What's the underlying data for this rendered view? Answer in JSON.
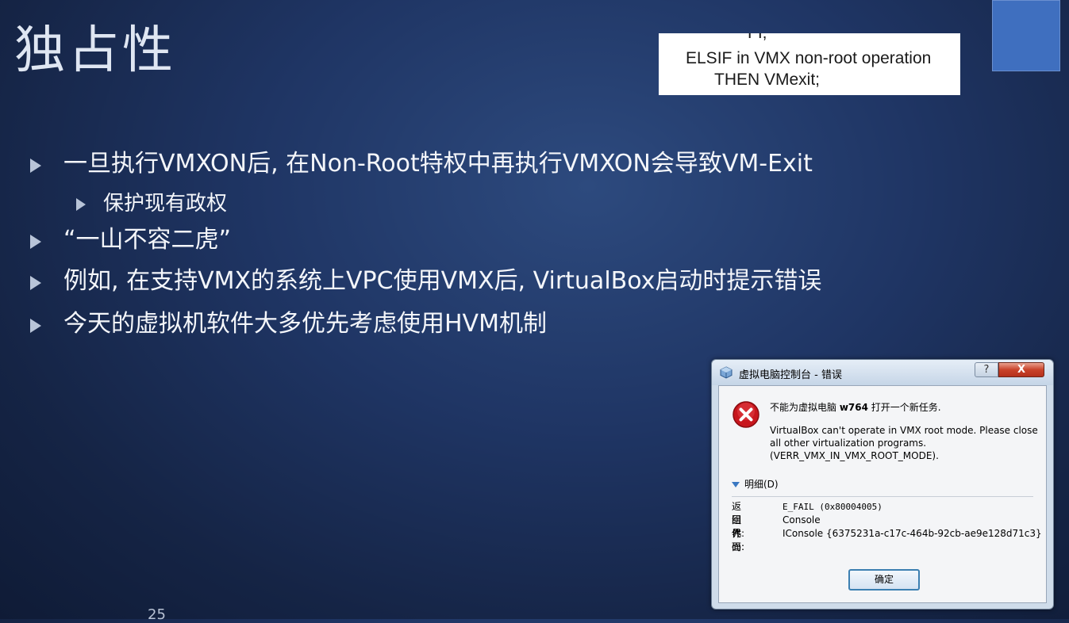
{
  "slide": {
    "title": "独占性",
    "page_number": "25",
    "code_snippet": {
      "line0": "FI;",
      "line1": "ELSIF in VMX non-root operation",
      "line2": "THEN VMexit;"
    },
    "bullets": [
      {
        "text": "一旦执行VMXON后, 在Non-Root特权中再执行VMXON会导致VM-Exit"
      },
      {
        "text": "保护现有政权"
      },
      {
        "text": "“一山不容二虎”"
      },
      {
        "text": "例如, 在支持VMX的系统上VPC使用VMX后, VirtualBox启动时提示错误"
      },
      {
        "text": "今天的虚拟机软件大多优先考虑使用HVM机制"
      }
    ]
  },
  "dialog": {
    "title": "虚拟电脑控制台 - 错误",
    "help_label": "?",
    "close_label": "X",
    "message_prefix": "不能为虚拟电脑 ",
    "vm_name": "w764",
    "message_suffix": " 打开一个新任务.",
    "detail_message": "VirtualBox can't operate in VMX root mode. Please close all other virtualization programs. (VERR_VMX_IN_VMX_ROOT_MODE).",
    "details_toggle": "明细(D)",
    "details": [
      {
        "key": "返回 代码:",
        "value": "E_FAIL (0x80004005)"
      },
      {
        "key": "组件:",
        "value": "Console"
      },
      {
        "key": "界面:",
        "value": "IConsole {6375231a-c17c-464b-92cb-ae9e128d71c3}"
      }
    ],
    "ok_label": "确定"
  },
  "colors": {
    "accent_square": "#3f6fbf",
    "error_red": "#c8161d",
    "ok_border": "#3c7fb1"
  }
}
